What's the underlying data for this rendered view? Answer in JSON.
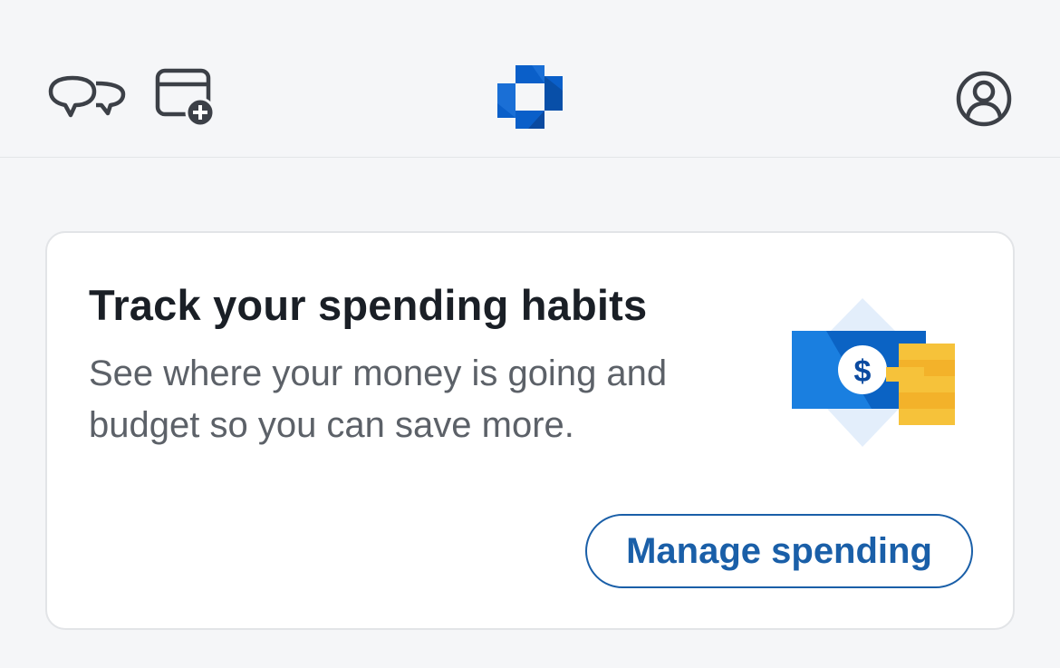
{
  "header": {
    "chat_icon": "chat-bubbles-icon",
    "add_card_icon": "card-add-icon",
    "logo": "chase-octagon-logo",
    "profile_icon": "profile-icon"
  },
  "promo_card": {
    "title": "Track your spending habits",
    "body": "See where your money is going and budget so you can save more.",
    "button_label": "Manage spending",
    "illustration_icon": "money-coins-icon"
  },
  "colors": {
    "background": "#f5f6f8",
    "card": "#ffffff",
    "brand_blue": "#1a5fa8",
    "logo_blue": "#0a5fc9",
    "coin_yellow": "#f6c23a",
    "title_text": "#1a1f26",
    "body_text": "#5c6168"
  }
}
